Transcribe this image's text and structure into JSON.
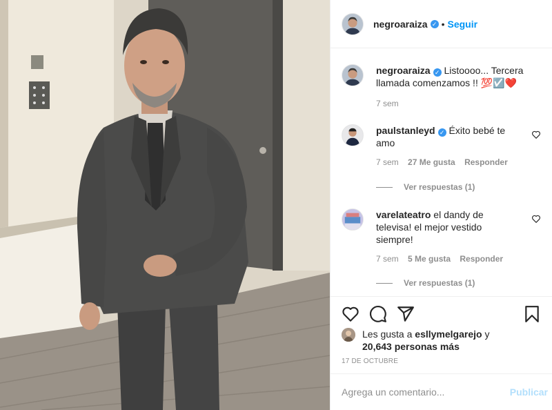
{
  "post": {
    "author": "negroaraiza",
    "follow_label": "Seguir",
    "dot": "•",
    "caption": {
      "username": "negroaraiza",
      "text": "Listoooo... Tercera llamada comenzamos !! 💯☑️❤️",
      "time": "7 sem"
    }
  },
  "comments": [
    {
      "username": "paulstanleyd",
      "text": "Éxito bebé te amo",
      "time": "7 sem",
      "likes": "27 Me gusta",
      "reply_label": "Responder",
      "view_replies": "Ver respuestas (1)"
    },
    {
      "username": "varelateatro",
      "text": "el dandy de televisa! el mejor vestido siempre!",
      "time": "7 sem",
      "likes": "5 Me gusta",
      "reply_label": "Responder",
      "view_replies": "Ver respuestas (1)"
    }
  ],
  "likes_line": {
    "prefix": "Les gusta a",
    "user": "esllymelgarejo",
    "conj": "y",
    "count": "20,643 personas más"
  },
  "date": "17 DE OCTUBRE",
  "comment_box": {
    "placeholder": "Agrega un comentario...",
    "publish_label": "Publicar"
  },
  "colors": {
    "accent": "#0095f6",
    "verified": "#3897f0",
    "muted": "#8e8e8e"
  },
  "icons": [
    "heart-icon",
    "comment-icon",
    "share-icon",
    "bookmark-icon",
    "verified-icon"
  ]
}
